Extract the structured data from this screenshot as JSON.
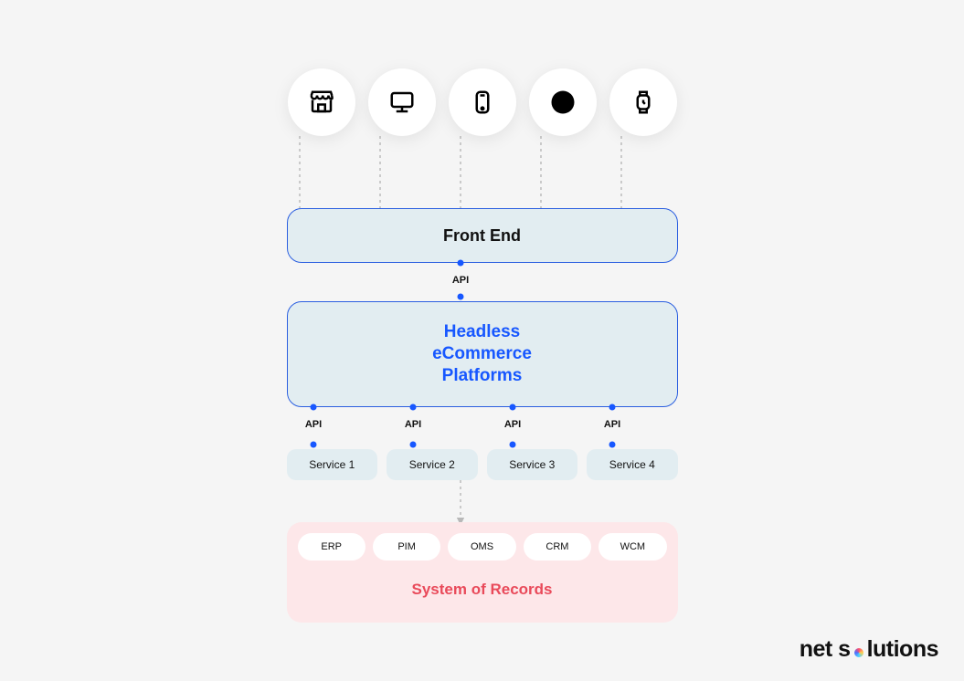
{
  "icons": [
    "storefront",
    "desktop",
    "mobile",
    "facebook",
    "smartwatch"
  ],
  "frontend": {
    "label": "Front End"
  },
  "api": {
    "label": "API"
  },
  "headless": {
    "label": "Headless\neCommerce\nPlatforms"
  },
  "services": [
    {
      "api": "API",
      "name": "Service 1"
    },
    {
      "api": "API",
      "name": "Service 2"
    },
    {
      "api": "API",
      "name": "Service 3"
    },
    {
      "api": "API",
      "name": "Service 4"
    }
  ],
  "records": {
    "items": [
      "ERP",
      "PIM",
      "OMS",
      "CRM",
      "WCM"
    ],
    "title": "System of Records"
  },
  "brand": {
    "first": "net s",
    "second": "lutions"
  }
}
